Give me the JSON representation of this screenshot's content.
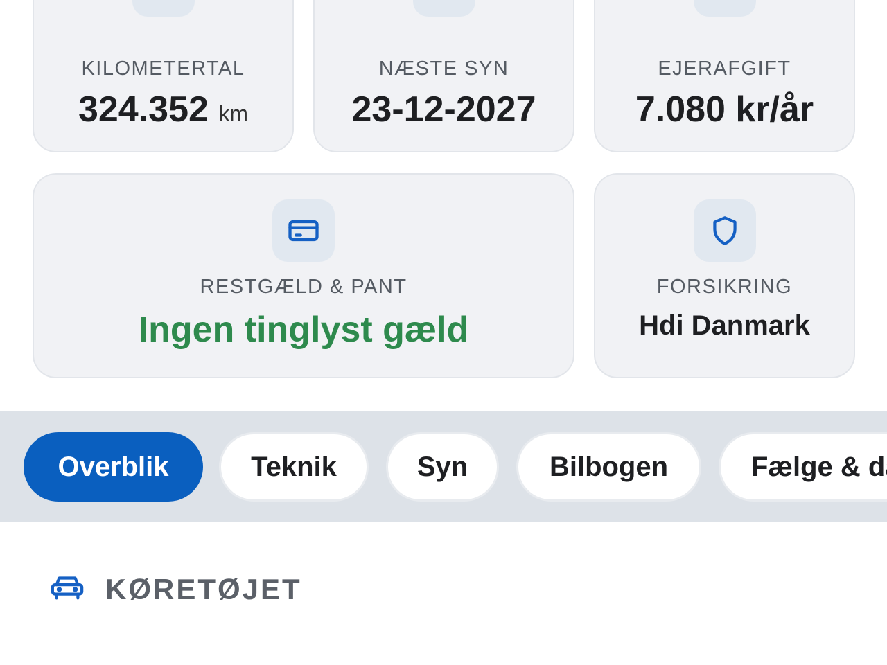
{
  "colors": {
    "accent": "#0a5fbf",
    "success": "#2e8a4d",
    "icon_blue": "#1560c4"
  },
  "stats": [
    {
      "icon": "clock-icon",
      "label": "KILOMETERTAL",
      "value": "324.352",
      "unit": "km"
    },
    {
      "icon": "calendar-icon",
      "label": "NÆSTE SYN",
      "value": "23-12-2027"
    },
    {
      "icon": "cash-icon",
      "label": "EJERAFGIFT",
      "value": "7.080 kr/år"
    }
  ],
  "debt": {
    "icon": "credit-card-icon",
    "label": "RESTGÆLD & PANT",
    "value": "Ingen tinglyst gæld"
  },
  "insurance": {
    "icon": "shield-icon",
    "label": "FORSIKRING",
    "value": "Hdi Danmark"
  },
  "tabs": [
    {
      "label": "Overblik",
      "active": true
    },
    {
      "label": "Teknik"
    },
    {
      "label": "Syn"
    },
    {
      "label": "Bilbogen"
    },
    {
      "label": "Fælge & dæk"
    }
  ],
  "section": {
    "icon": "car-icon",
    "title": "KØRETØJET"
  }
}
